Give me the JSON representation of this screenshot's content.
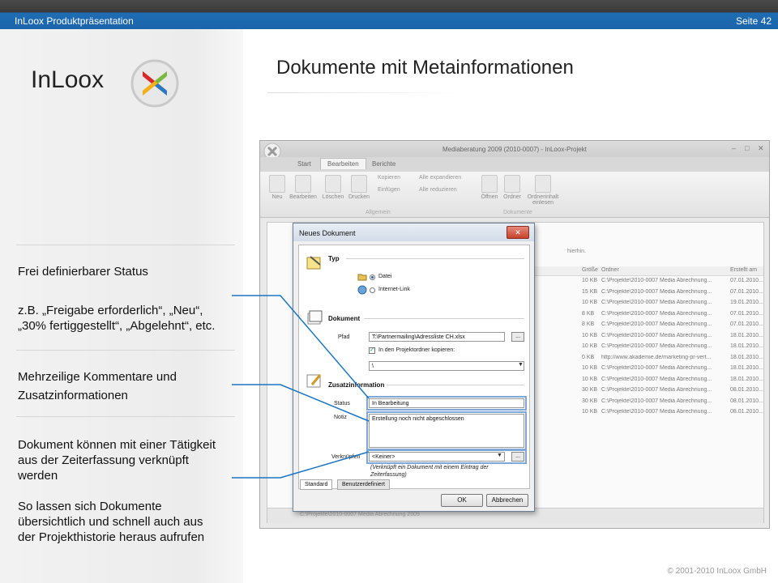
{
  "header": {
    "left_title": "InLoox Produktpräsentation",
    "page": "Seite 42"
  },
  "logo": {
    "text": "InLoox"
  },
  "title": "Dokumente mit Metainformationen",
  "left_panel": {
    "status_heading": "Frei definierbarer Status",
    "status_examples": [
      "z.B. „Freigabe erforderlich“, „Neu“,",
      "„30% fertiggestellt“, „Abgelehnt“, etc."
    ],
    "comments": [
      "Mehrzeilige Kommentare und",
      "Zusatzinformationen"
    ],
    "link_text": [
      "Dokument können mit einer Tätigkeit",
      "aus der Zeiterfassung verknüpft",
      "werden"
    ],
    "history_text": [
      "So lassen sich Dokumente",
      "übersichtlich und schnell auch aus",
      "der Projekthistorie heraus aufrufen"
    ]
  },
  "app": {
    "window_title": "Mediaberatung 2009 (2010-0007) - InLoox-Projekt",
    "tabs": [
      "Start",
      "Bearbeiten",
      "Berichte"
    ],
    "ribbon": {
      "neu": "Neu",
      "bearbeiten": "Bearbeiten",
      "loeschen": "Löschen",
      "drucken": "Drucken",
      "kopieren": "Kopieren",
      "einfuegen": "Einfügen",
      "alle_expandieren": "Alle expandieren",
      "alle_reduzieren": "Alle reduzieren",
      "oeffnen": "Öffnen",
      "ordner": "Ordner",
      "ordnerinhalt": "Ordnerinhalt einlesen",
      "group_allgemein": "Allgemein",
      "group_dokumente": "Dokumente"
    },
    "drop_hint": "hierhin.",
    "grid_headers": [
      "Größe",
      "Ordner",
      "Erstellt am"
    ],
    "grid_rows": [
      {
        "size": "10 KB",
        "folder": "C:\\Projekte\\2010-0007 Media Abrechnung...",
        "date": "07.01.2010..."
      },
      {
        "size": "15 KB",
        "folder": "C:\\Projekte\\2010-0007 Media Abrechnung...",
        "date": "07.01.2010..."
      },
      {
        "size": "10 KB",
        "folder": "C:\\Projekte\\2010-0007 Media Abrechnung...",
        "date": "19.01.2010..."
      },
      {
        "size": "8 KB",
        "folder": "C:\\Projekte\\2010-0007 Media Abrechnung...",
        "date": "07.01.2010..."
      },
      {
        "size": "8 KB",
        "folder": "C:\\Projekte\\2010-0007 Media Abrechnung...",
        "date": "07.01.2010..."
      },
      {
        "size": "10 KB",
        "folder": "C:\\Projekte\\2010-0007 Media Abrechnung...",
        "date": "18.01.2010..."
      },
      {
        "size": "10 KB",
        "folder": "C:\\Projekte\\2010-0007 Media Abrechnung...",
        "date": "18.01.2010..."
      },
      {
        "size": "0 KB",
        "folder": "http://www.akademie.de/marketing-pr-vert...",
        "date": "18.01.2010..."
      },
      {
        "size": "10 KB",
        "folder": "C:\\Projekte\\2010-0007 Media Abrechnung...",
        "date": "18.01.2010..."
      },
      {
        "size": "10 KB",
        "folder": "C:\\Projekte\\2010-0007 Media Abrechnung...",
        "date": "18.01.2010..."
      },
      {
        "size": "30 KB",
        "folder": "C:\\Projekte\\2010-0007 Media Abrechnung...",
        "date": "08.01.2010..."
      },
      {
        "size": "30 KB",
        "folder": "C:\\Projekte\\2010-0007 Media Abrechnung...",
        "date": "08.01.2010..."
      },
      {
        "size": "10 KB",
        "folder": "C:\\Projekte\\2010-0007 Media Abrechnung...",
        "date": "08.01.2010..."
      }
    ],
    "status_path": "C:\\Projekte\\2010-0007 Media Abrechnung 2009"
  },
  "dialog": {
    "title": "Neues Dokument",
    "close": "✕",
    "typ_section": "Typ",
    "datei": "Datei",
    "internet_link": "Internet-Link",
    "dokument_section": "Dokument",
    "pfad_label": "Pfad",
    "pfad_value": "T:\\Partnermailing\\Adressliste CH.xlsx",
    "browse": "...",
    "copy_label": "In den Projektordner kopieren:",
    "copy_target": "\\",
    "zusatz_section": "Zusatzinformation",
    "status_label": "Status",
    "status_value": "In Bearbeitung",
    "notiz_label": "Notiz",
    "notiz_value": "Erstellung noch nicht abgeschlossen",
    "verkn_label": "Verknüpfen",
    "verkn_value": "<Keiner>",
    "verkn_hint": "(Verknüpft ein Dokument mit einem Eintrag der Zeiterfassung)",
    "tab_standard": "Standard",
    "tab_benutzer": "Benutzerdefiniert",
    "ok": "OK",
    "cancel": "Abbrechen"
  },
  "footer": "© 2001-2010 InLoox GmbH",
  "colors": {
    "header_blue": "#1f6db3",
    "callout": "#1b75c4"
  }
}
